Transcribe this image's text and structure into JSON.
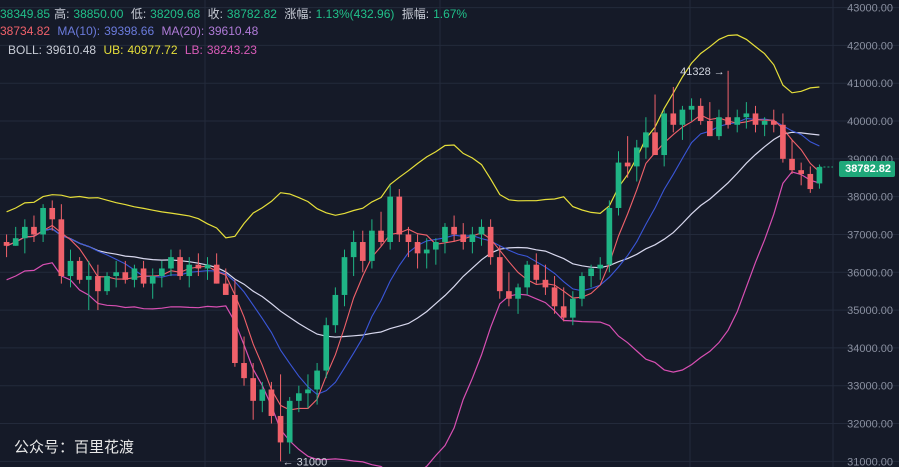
{
  "header": {
    "open": "38349.85",
    "high_label": "高:",
    "high": "38850.00",
    "low_label": "低:",
    "low": "38209.68",
    "close_label": "收:",
    "close": "38782.82",
    "change_label": "涨幅:",
    "change": "1.13%(432.96)",
    "amp_label": "振幅:",
    "amp": "1.67%"
  },
  "ma": {
    "ma5": "38734.82",
    "ma10_label": "MA(10):",
    "ma10": "39398.66",
    "ma20_label": "MA(20):",
    "ma20": "39610.48"
  },
  "boll": {
    "boll_label": "BOLL:",
    "boll": "39610.48",
    "ub_label": "UB:",
    "ub": "40977.72",
    "lb_label": "LB:",
    "lb": "38243.23"
  },
  "watermark": "公众号：百里花渡",
  "current_price": "38782.82",
  "annotations": {
    "high_mark": "41328",
    "low_mark": "31000"
  },
  "colors": {
    "up": "#1fb485",
    "down": "#f0616a",
    "ma5": "#f0616a",
    "ma10": "#3a56d8",
    "ma20": "#d8d8ee",
    "ub": "#e6df3a",
    "lb": "#d84fb3",
    "grid": "#232a3b",
    "bg": "#151a28"
  },
  "chart_data": {
    "type": "candlestick",
    "y_ticks": [
      "31000.00",
      "32000.00",
      "33000.00",
      "34000.00",
      "35000.00",
      "36000.00",
      "37000.00",
      "38000.00",
      "39000.00",
      "40000.00",
      "41000.00",
      "42000.00",
      "43000.00"
    ],
    "ylim": [
      30850,
      43200
    ],
    "candles": [
      [
        36800,
        37000,
        36400,
        36700
      ],
      [
        36700,
        37200,
        36700,
        36900
      ],
      [
        36900,
        37400,
        36500,
        37200
      ],
      [
        37200,
        37500,
        36800,
        37000
      ],
      [
        37000,
        37800,
        36800,
        37700
      ],
      [
        37700,
        37900,
        37100,
        37400
      ],
      [
        37400,
        37800,
        35700,
        35900
      ],
      [
        35900,
        36600,
        35600,
        36300
      ],
      [
        36300,
        36400,
        35700,
        35800
      ],
      [
        35800,
        36300,
        35000,
        35900
      ],
      [
        35900,
        36200,
        35000,
        35500
      ],
      [
        35500,
        36000,
        35400,
        35900
      ],
      [
        35900,
        36300,
        35600,
        36000
      ],
      [
        36000,
        36300,
        35700,
        35800
      ],
      [
        35800,
        36200,
        35600,
        36100
      ],
      [
        36100,
        36300,
        35600,
        35700
      ],
      [
        35700,
        36100,
        35300,
        35900
      ],
      [
        35900,
        36300,
        35600,
        36100
      ],
      [
        36100,
        36600,
        35900,
        36400
      ],
      [
        36400,
        36600,
        35800,
        35900
      ],
      [
        35900,
        36400,
        35600,
        36200
      ],
      [
        36200,
        36500,
        35900,
        36100
      ],
      [
        36100,
        36400,
        35800,
        36200
      ],
      [
        36200,
        36500,
        35700,
        35700
      ],
      [
        35700,
        36100,
        35500,
        35400
      ],
      [
        35400,
        35800,
        33500,
        33600
      ],
      [
        33600,
        34300,
        33000,
        33200
      ],
      [
        33200,
        33600,
        32100,
        32600
      ],
      [
        32600,
        33100,
        32300,
        32900
      ],
      [
        32900,
        33100,
        32000,
        32200
      ],
      [
        32200,
        33300,
        31000,
        31500
      ],
      [
        31500,
        32700,
        31200,
        32600
      ],
      [
        32600,
        33000,
        32300,
        32800
      ],
      [
        32800,
        33300,
        32400,
        32900
      ],
      [
        32900,
        33600,
        32500,
        33400
      ],
      [
        33400,
        34800,
        33200,
        34600
      ],
      [
        34600,
        35600,
        34400,
        35400
      ],
      [
        35400,
        36600,
        35100,
        36400
      ],
      [
        36400,
        37100,
        35900,
        36800
      ],
      [
        36800,
        37100,
        36000,
        36300
      ],
      [
        36300,
        37400,
        36100,
        37100
      ],
      [
        37100,
        37600,
        36700,
        36800
      ],
      [
        36800,
        38300,
        36600,
        38000
      ],
      [
        38000,
        38200,
        36800,
        37000
      ],
      [
        37000,
        37200,
        36400,
        36800
      ],
      [
        36800,
        37000,
        36100,
        36500
      ],
      [
        36500,
        36900,
        36100,
        36600
      ],
      [
        36600,
        36900,
        36200,
        36800
      ],
      [
        36800,
        37300,
        36500,
        37200
      ],
      [
        37200,
        37500,
        36800,
        37000
      ],
      [
        37000,
        37300,
        36600,
        36800
      ],
      [
        36800,
        37200,
        36500,
        37000
      ],
      [
        37000,
        37400,
        36700,
        37200
      ],
      [
        37200,
        37400,
        36200,
        36400
      ],
      [
        36400,
        36700,
        35300,
        35500
      ],
      [
        35500,
        36000,
        35100,
        35300
      ],
      [
        35300,
        35700,
        34900,
        35600
      ],
      [
        35600,
        36300,
        35400,
        36200
      ],
      [
        36200,
        36500,
        35700,
        35800
      ],
      [
        35800,
        36200,
        35400,
        35600
      ],
      [
        35600,
        35900,
        34900,
        35100
      ],
      [
        35100,
        35600,
        34700,
        34800
      ],
      [
        34800,
        35500,
        34600,
        35300
      ],
      [
        35300,
        36000,
        35100,
        35900
      ],
      [
        35900,
        36200,
        35600,
        36100
      ],
      [
        36100,
        36400,
        35800,
        36200
      ],
      [
        36200,
        37900,
        36000,
        37700
      ],
      [
        37700,
        39200,
        37500,
        38900
      ],
      [
        38900,
        39600,
        38500,
        38800
      ],
      [
        38800,
        39500,
        38400,
        39300
      ],
      [
        39300,
        40100,
        39000,
        39700
      ],
      [
        39700,
        40700,
        39200,
        39100
      ],
      [
        39100,
        40300,
        38800,
        40200
      ],
      [
        40200,
        40900,
        39700,
        39900
      ],
      [
        39900,
        40400,
        39500,
        40300
      ],
      [
        40300,
        40600,
        40000,
        40400
      ],
      [
        40400,
        40600,
        39900,
        40000
      ],
      [
        40000,
        40500,
        39600,
        39600
      ],
      [
        39600,
        40300,
        39500,
        40100
      ],
      [
        40100,
        41328,
        39800,
        39900
      ],
      [
        39900,
        40300,
        39700,
        40100
      ],
      [
        40100,
        40500,
        39800,
        40200
      ],
      [
        40200,
        40400,
        39700,
        39900
      ],
      [
        39900,
        40100,
        39600,
        40000
      ],
      [
        40000,
        40300,
        39700,
        39900
      ],
      [
        39900,
        40200,
        38900,
        39000
      ],
      [
        39000,
        39500,
        38600,
        38700
      ],
      [
        38700,
        38900,
        38300,
        38600
      ],
      [
        38600,
        38800,
        38100,
        38200
      ],
      [
        38349.85,
        38850,
        38209.68,
        38782.82
      ]
    ]
  }
}
